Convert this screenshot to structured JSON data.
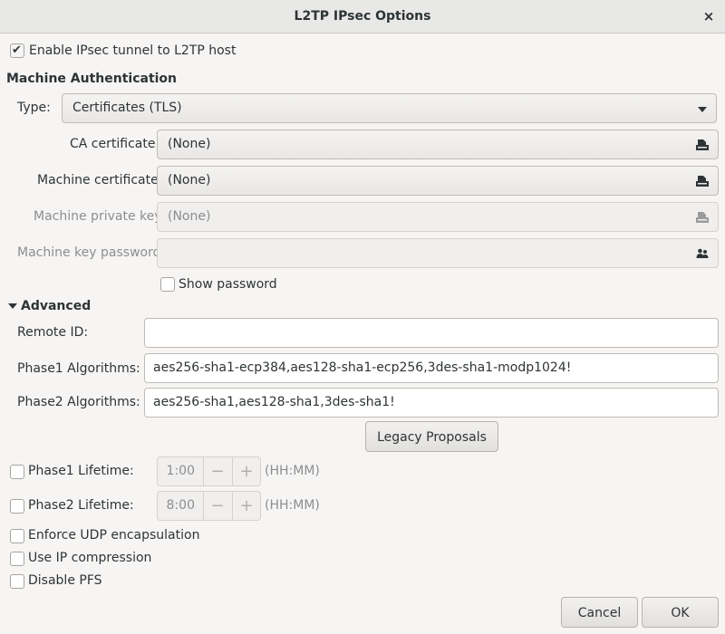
{
  "window": {
    "title": "L2TP IPsec Options",
    "close_glyph": "×"
  },
  "enable_ipsec": {
    "label": "Enable IPsec tunnel to L2TP host",
    "checked": true
  },
  "machine_auth": {
    "heading": "Machine Authentication",
    "type_label": "Type:",
    "type_value": "Certificates (TLS)",
    "ca_cert": {
      "label": "CA certificate",
      "value": "(None)"
    },
    "machine_cert": {
      "label": "Machine certificate",
      "value": "(None)"
    },
    "private_key": {
      "label": "Machine private key",
      "value": "(None)"
    },
    "key_password": {
      "label": "Machine key password",
      "value": ""
    },
    "show_password": {
      "label": "Show password",
      "checked": false
    }
  },
  "advanced": {
    "heading": "Advanced",
    "remote_id": {
      "label": "Remote ID:",
      "value": ""
    },
    "phase1_alg": {
      "label": "Phase1 Algorithms:",
      "value": "aes256-sha1-ecp384,aes128-sha1-ecp256,3des-sha1-modp1024!"
    },
    "phase2_alg": {
      "label": "Phase2 Algorithms:",
      "value": "aes256-sha1,aes128-sha1,3des-sha1!"
    },
    "legacy_button": "Legacy Proposals",
    "phase1_lifetime": {
      "label": "Phase1 Lifetime:",
      "value": "1:00",
      "unit": "(HH:MM)",
      "checked": false
    },
    "phase2_lifetime": {
      "label": "Phase2 Lifetime:",
      "value": "8:00",
      "unit": "(HH:MM)",
      "checked": false
    },
    "enforce_udp": {
      "label": "Enforce UDP encapsulation",
      "checked": false
    },
    "ip_compression": {
      "label": "Use IP compression",
      "checked": false
    },
    "disable_pfs": {
      "label": "Disable PFS",
      "checked": false
    },
    "minus_glyph": "−",
    "plus_glyph": "+"
  },
  "buttons": {
    "cancel": "Cancel",
    "ok": "OK"
  },
  "icons": {
    "file": "document-open-icon",
    "users": "user-password-icon",
    "check": "✔"
  }
}
